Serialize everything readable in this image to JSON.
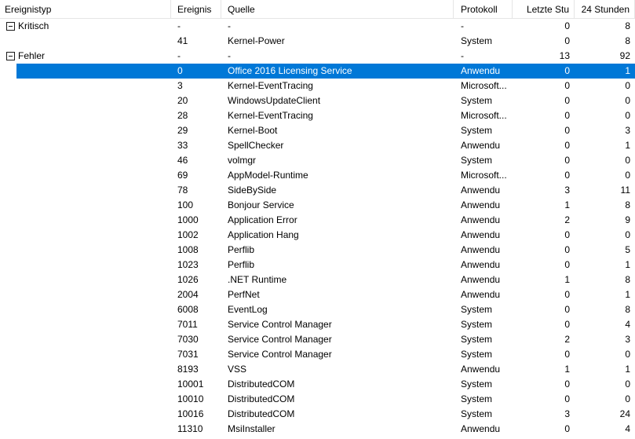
{
  "columns": {
    "type": "Ereignistyp",
    "event": "Ereignis",
    "source": "Quelle",
    "log": "Protokoll",
    "last_hour": "Letzte Stu",
    "day": "24 Stunden"
  },
  "colors": {
    "selection": "#0078d7",
    "selection_text": "#ffffff",
    "grid_line": "#e5e5e5"
  },
  "rows": [
    {
      "kind": "group",
      "label": "Kritisch",
      "event": "-",
      "source": "-",
      "log": "-",
      "last": "0",
      "day": "8"
    },
    {
      "kind": "item",
      "event": "41",
      "source": "Kernel-Power",
      "log": "System",
      "last": "0",
      "day": "8"
    },
    {
      "kind": "group",
      "label": "Fehler",
      "event": "-",
      "source": "-",
      "log": "-",
      "last": "13",
      "day": "92"
    },
    {
      "kind": "item",
      "selected": true,
      "event": "0",
      "source": "Office 2016 Licensing Service",
      "log": "Anwendu",
      "last": "0",
      "day": "1"
    },
    {
      "kind": "item",
      "event": "3",
      "source": "Kernel-EventTracing",
      "log": "Microsoft...",
      "last": "0",
      "day": "0"
    },
    {
      "kind": "item",
      "event": "20",
      "source": "WindowsUpdateClient",
      "log": "System",
      "last": "0",
      "day": "0"
    },
    {
      "kind": "item",
      "event": "28",
      "source": "Kernel-EventTracing",
      "log": "Microsoft...",
      "last": "0",
      "day": "0"
    },
    {
      "kind": "item",
      "event": "29",
      "source": "Kernel-Boot",
      "log": "System",
      "last": "0",
      "day": "3"
    },
    {
      "kind": "item",
      "event": "33",
      "source": "SpellChecker",
      "log": "Anwendu",
      "last": "0",
      "day": "1"
    },
    {
      "kind": "item",
      "event": "46",
      "source": "volmgr",
      "log": "System",
      "last": "0",
      "day": "0"
    },
    {
      "kind": "item",
      "event": "69",
      "source": "AppModel-Runtime",
      "log": "Microsoft...",
      "last": "0",
      "day": "0"
    },
    {
      "kind": "item",
      "event": "78",
      "source": "SideBySide",
      "log": "Anwendu",
      "last": "3",
      "day": "11"
    },
    {
      "kind": "item",
      "event": "100",
      "source": "Bonjour Service",
      "log": "Anwendu",
      "last": "1",
      "day": "8"
    },
    {
      "kind": "item",
      "event": "1000",
      "source": "Application Error",
      "log": "Anwendu",
      "last": "2",
      "day": "9"
    },
    {
      "kind": "item",
      "event": "1002",
      "source": "Application Hang",
      "log": "Anwendu",
      "last": "0",
      "day": "0"
    },
    {
      "kind": "item",
      "event": "1008",
      "source": "Perflib",
      "log": "Anwendu",
      "last": "0",
      "day": "5"
    },
    {
      "kind": "item",
      "event": "1023",
      "source": "Perflib",
      "log": "Anwendu",
      "last": "0",
      "day": "1"
    },
    {
      "kind": "item",
      "event": "1026",
      "source": ".NET Runtime",
      "log": "Anwendu",
      "last": "1",
      "day": "8"
    },
    {
      "kind": "item",
      "event": "2004",
      "source": "PerfNet",
      "log": "Anwendu",
      "last": "0",
      "day": "1"
    },
    {
      "kind": "item",
      "event": "6008",
      "source": "EventLog",
      "log": "System",
      "last": "0",
      "day": "8"
    },
    {
      "kind": "item",
      "event": "7011",
      "source": "Service Control Manager",
      "log": "System",
      "last": "0",
      "day": "4"
    },
    {
      "kind": "item",
      "event": "7030",
      "source": "Service Control Manager",
      "log": "System",
      "last": "2",
      "day": "3"
    },
    {
      "kind": "item",
      "event": "7031",
      "source": "Service Control Manager",
      "log": "System",
      "last": "0",
      "day": "0"
    },
    {
      "kind": "item",
      "event": "8193",
      "source": "VSS",
      "log": "Anwendu",
      "last": "1",
      "day": "1"
    },
    {
      "kind": "item",
      "event": "10001",
      "source": "DistributedCOM",
      "log": "System",
      "last": "0",
      "day": "0"
    },
    {
      "kind": "item",
      "event": "10010",
      "source": "DistributedCOM",
      "log": "System",
      "last": "0",
      "day": "0"
    },
    {
      "kind": "item",
      "event": "10016",
      "source": "DistributedCOM",
      "log": "System",
      "last": "3",
      "day": "24"
    },
    {
      "kind": "item",
      "event": "11310",
      "source": "MsiInstaller",
      "log": "Anwendu",
      "last": "0",
      "day": "4"
    }
  ]
}
